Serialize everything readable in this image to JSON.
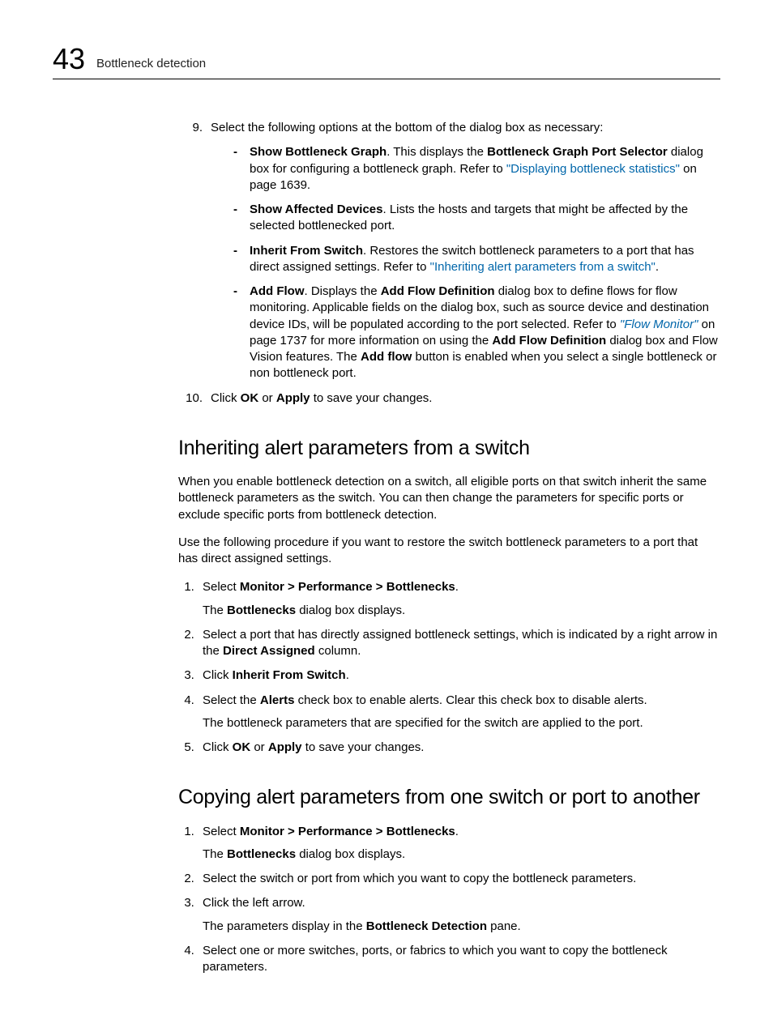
{
  "header": {
    "chapter_number": "43",
    "section_title": "Bottleneck detection"
  },
  "top_list": {
    "item9": {
      "num": "9.",
      "intro": "Select the following options at the bottom of the dialog box as necessary:",
      "bullets": [
        {
          "lead": "Show Bottleneck Graph",
          "t1": ". This displays the ",
          "b1": "Bottleneck Graph Port Selector",
          "t2": " dialog box for configuring a bottleneck graph. Refer to ",
          "link": "\"Displaying bottleneck statistics\"",
          "t3": " on page 1639."
        },
        {
          "lead": "Show Affected Devices",
          "t1": ". Lists the hosts and targets that might be affected by the selected bottlenecked port."
        },
        {
          "lead": "Inherit From Switch",
          "t1": ". Restores the switch bottleneck parameters to a port that has direct assigned settings. Refer to ",
          "link": "\"Inheriting alert parameters from a switch\"",
          "t3": "."
        },
        {
          "lead": "Add Flow",
          "t1": ". Displays the ",
          "b1": "Add Flow Definition",
          "t2": " dialog box to define flows for flow monitoring. Applicable fields on the dialog box, such as source device and destination device IDs, will be populated according to the port selected. Refer to ",
          "linki": "\"Flow Monitor\"",
          "t3": " on page 1737 for more information on using the ",
          "b2": "Add Flow Definition",
          "t4": " dialog box and Flow Vision features. The ",
          "b3": "Add flow",
          "t5": " button is enabled when you select a single bottleneck or non bottleneck port."
        }
      ]
    },
    "item10": {
      "num": "10.",
      "pre": "Click ",
      "b1": "OK",
      "mid": " or ",
      "b2": "Apply",
      "post": " to save your changes."
    }
  },
  "sectionA": {
    "heading": "Inheriting alert parameters from a switch",
    "para1": "When you enable bottleneck detection on a switch, all eligible ports on that switch inherit the same bottleneck parameters as the switch. You can then change the parameters for specific ports or exclude specific ports from bottleneck detection.",
    "para2": "Use the following procedure if you want to restore the switch bottleneck parameters to a port that has direct assigned settings.",
    "steps": {
      "s1": {
        "pre": "Select ",
        "b": "Monitor > Performance > Bottlenecks",
        "post": ".",
        "follow_pre": "The ",
        "follow_b": "Bottlenecks",
        "follow_post": " dialog box displays."
      },
      "s2": {
        "pre": "Select a port that has directly assigned bottleneck settings, which is indicated by a right arrow in the ",
        "b": "Direct Assigned",
        "post": " column."
      },
      "s3": {
        "pre": "Click ",
        "b": "Inherit From Switch",
        "post": "."
      },
      "s4": {
        "pre": "Select the ",
        "b": "Alerts",
        "post": " check box to enable alerts. Clear this check box to disable alerts.",
        "follow": "The bottleneck parameters that are specified for the switch are applied to the port."
      },
      "s5": {
        "pre": "Click ",
        "b1": "OK",
        "mid": " or ",
        "b2": "Apply",
        "post": " to save your changes."
      }
    }
  },
  "sectionB": {
    "heading": "Copying alert parameters from one switch or port to another",
    "steps": {
      "s1": {
        "pre": "Select ",
        "b": "Monitor > Performance > Bottlenecks",
        "post": ".",
        "follow_pre": "The ",
        "follow_b": "Bottlenecks",
        "follow_post": " dialog box displays."
      },
      "s2": {
        "text": "Select the switch or port from which you want to copy the bottleneck parameters."
      },
      "s3": {
        "text": "Click the left arrow.",
        "follow_pre": "The parameters display in the ",
        "follow_b": "Bottleneck Detection",
        "follow_post": " pane."
      },
      "s4": {
        "text": "Select one or more switches, ports, or fabrics to which you want to copy the bottleneck parameters."
      }
    }
  }
}
